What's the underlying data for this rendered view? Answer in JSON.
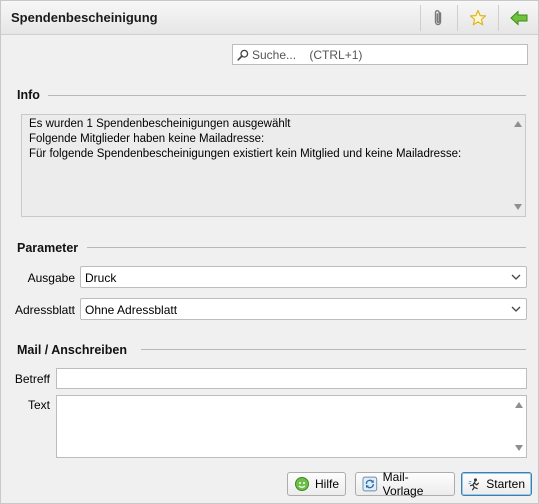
{
  "window": {
    "title": "Spendenbescheinigung"
  },
  "toolbar": {
    "icons": [
      "paperclip-icon",
      "star-icon",
      "back-arrow-icon"
    ]
  },
  "search": {
    "placeholder": "Suche...    (CTRL+1)"
  },
  "info": {
    "title": "Info",
    "lines": [
      "Es wurden 1 Spendenbescheinigungen ausgewählt",
      "Folgende Mitglieder haben keine Mailadresse:",
      "Für folgende Spendenbescheinigungen existiert kein Mitglied und keine Mailadresse:"
    ]
  },
  "parameter": {
    "title": "Parameter",
    "ausgabe": {
      "label": "Ausgabe",
      "value": "Druck"
    },
    "adressblatt": {
      "label": "Adressblatt",
      "value": "Ohne Adressblatt"
    }
  },
  "mail": {
    "title": "Mail / Anschreiben",
    "betreff": {
      "label": "Betreff",
      "value": ""
    },
    "text": {
      "label": "Text",
      "value": ""
    }
  },
  "buttons": {
    "hilfe": "Hilfe",
    "mail_vorlage": "Mail-Vorlage",
    "starten": "Starten"
  },
  "colors": {
    "accent_green": "#5aa832",
    "star_yellow": "#e0b422",
    "primary_border": "#3c7fb1"
  }
}
